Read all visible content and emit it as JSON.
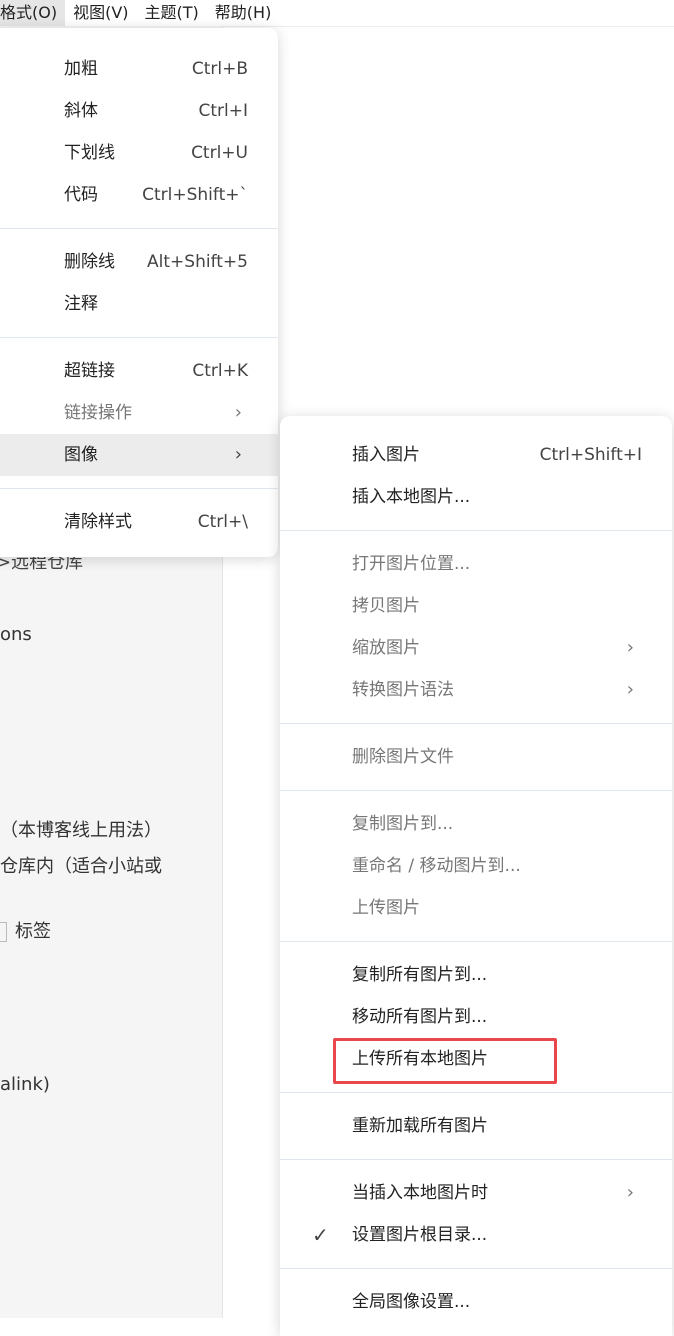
{
  "menubar": {
    "items": [
      "格式(O)",
      "视图(V)",
      "主题(T)",
      "帮助(H)"
    ]
  },
  "background": {
    "lines": [
      ">远程仓库",
      "ons",
      "（本博客线上用法）",
      "仓库内（适合小站或",
      "标签",
      "alink)"
    ]
  },
  "format_menu": {
    "groups": [
      [
        {
          "label": "加粗",
          "shortcut": "Ctrl+B"
        },
        {
          "label": "斜体",
          "shortcut": "Ctrl+I"
        },
        {
          "label": "下划线",
          "shortcut": "Ctrl+U"
        },
        {
          "label": "代码",
          "shortcut": "Ctrl+Shift+`"
        }
      ],
      [
        {
          "label": "删除线",
          "shortcut": "Alt+Shift+5"
        },
        {
          "label": "注释",
          "shortcut": ""
        }
      ],
      [
        {
          "label": "超链接",
          "shortcut": "Ctrl+K"
        },
        {
          "label": "链接操作",
          "submenu": true,
          "disabled": true
        },
        {
          "label": "图像",
          "submenu": true,
          "hover": true
        }
      ],
      [
        {
          "label": "清除样式",
          "shortcut": "Ctrl+\\"
        }
      ]
    ]
  },
  "image_menu": {
    "groups": [
      [
        {
          "label": "插入图片",
          "shortcut": "Ctrl+Shift+I"
        },
        {
          "label": "插入本地图片..."
        }
      ],
      [
        {
          "label": "打开图片位置...",
          "disabled": true
        },
        {
          "label": "拷贝图片",
          "disabled": true
        },
        {
          "label": "缩放图片",
          "disabled": true,
          "submenu": true
        },
        {
          "label": "转换图片语法",
          "disabled": true,
          "submenu": true
        }
      ],
      [
        {
          "label": "删除图片文件",
          "disabled": true
        }
      ],
      [
        {
          "label": "复制图片到...",
          "disabled": true
        },
        {
          "label": "重命名 / 移动图片到...",
          "disabled": true
        },
        {
          "label": "上传图片",
          "disabled": true
        }
      ],
      [
        {
          "label": "复制所有图片到..."
        },
        {
          "label": "移动所有图片到..."
        },
        {
          "label": "上传所有本地图片",
          "highlighted": true
        }
      ],
      [
        {
          "label": "重新加载所有图片"
        }
      ],
      [
        {
          "label": "当插入本地图片时",
          "submenu": true
        },
        {
          "label": "设置图片根目录...",
          "checked": true
        }
      ],
      [
        {
          "label": "全局图像设置..."
        }
      ]
    ]
  },
  "icons": {
    "submenu": "chevron-right-icon",
    "check": "checkmark-icon"
  },
  "colors": {
    "highlight_border": "#e8474c",
    "hover_bg": "#ececec",
    "separator": "#dfe6ee"
  }
}
